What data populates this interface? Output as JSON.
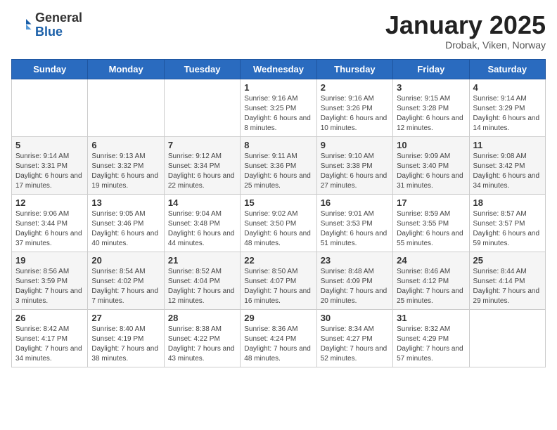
{
  "header": {
    "logo_general": "General",
    "logo_blue": "Blue",
    "month_title": "January 2025",
    "location": "Drobak, Viken, Norway"
  },
  "weekdays": [
    "Sunday",
    "Monday",
    "Tuesday",
    "Wednesday",
    "Thursday",
    "Friday",
    "Saturday"
  ],
  "weeks": [
    [
      {
        "day": "",
        "info": ""
      },
      {
        "day": "",
        "info": ""
      },
      {
        "day": "",
        "info": ""
      },
      {
        "day": "1",
        "info": "Sunrise: 9:16 AM\nSunset: 3:25 PM\nDaylight: 6 hours and 8 minutes."
      },
      {
        "day": "2",
        "info": "Sunrise: 9:16 AM\nSunset: 3:26 PM\nDaylight: 6 hours and 10 minutes."
      },
      {
        "day": "3",
        "info": "Sunrise: 9:15 AM\nSunset: 3:28 PM\nDaylight: 6 hours and 12 minutes."
      },
      {
        "day": "4",
        "info": "Sunrise: 9:14 AM\nSunset: 3:29 PM\nDaylight: 6 hours and 14 minutes."
      }
    ],
    [
      {
        "day": "5",
        "info": "Sunrise: 9:14 AM\nSunset: 3:31 PM\nDaylight: 6 hours and 17 minutes."
      },
      {
        "day": "6",
        "info": "Sunrise: 9:13 AM\nSunset: 3:32 PM\nDaylight: 6 hours and 19 minutes."
      },
      {
        "day": "7",
        "info": "Sunrise: 9:12 AM\nSunset: 3:34 PM\nDaylight: 6 hours and 22 minutes."
      },
      {
        "day": "8",
        "info": "Sunrise: 9:11 AM\nSunset: 3:36 PM\nDaylight: 6 hours and 25 minutes."
      },
      {
        "day": "9",
        "info": "Sunrise: 9:10 AM\nSunset: 3:38 PM\nDaylight: 6 hours and 27 minutes."
      },
      {
        "day": "10",
        "info": "Sunrise: 9:09 AM\nSunset: 3:40 PM\nDaylight: 6 hours and 31 minutes."
      },
      {
        "day": "11",
        "info": "Sunrise: 9:08 AM\nSunset: 3:42 PM\nDaylight: 6 hours and 34 minutes."
      }
    ],
    [
      {
        "day": "12",
        "info": "Sunrise: 9:06 AM\nSunset: 3:44 PM\nDaylight: 6 hours and 37 minutes."
      },
      {
        "day": "13",
        "info": "Sunrise: 9:05 AM\nSunset: 3:46 PM\nDaylight: 6 hours and 40 minutes."
      },
      {
        "day": "14",
        "info": "Sunrise: 9:04 AM\nSunset: 3:48 PM\nDaylight: 6 hours and 44 minutes."
      },
      {
        "day": "15",
        "info": "Sunrise: 9:02 AM\nSunset: 3:50 PM\nDaylight: 6 hours and 48 minutes."
      },
      {
        "day": "16",
        "info": "Sunrise: 9:01 AM\nSunset: 3:53 PM\nDaylight: 6 hours and 51 minutes."
      },
      {
        "day": "17",
        "info": "Sunrise: 8:59 AM\nSunset: 3:55 PM\nDaylight: 6 hours and 55 minutes."
      },
      {
        "day": "18",
        "info": "Sunrise: 8:57 AM\nSunset: 3:57 PM\nDaylight: 6 hours and 59 minutes."
      }
    ],
    [
      {
        "day": "19",
        "info": "Sunrise: 8:56 AM\nSunset: 3:59 PM\nDaylight: 7 hours and 3 minutes."
      },
      {
        "day": "20",
        "info": "Sunrise: 8:54 AM\nSunset: 4:02 PM\nDaylight: 7 hours and 7 minutes."
      },
      {
        "day": "21",
        "info": "Sunrise: 8:52 AM\nSunset: 4:04 PM\nDaylight: 7 hours and 12 minutes."
      },
      {
        "day": "22",
        "info": "Sunrise: 8:50 AM\nSunset: 4:07 PM\nDaylight: 7 hours and 16 minutes."
      },
      {
        "day": "23",
        "info": "Sunrise: 8:48 AM\nSunset: 4:09 PM\nDaylight: 7 hours and 20 minutes."
      },
      {
        "day": "24",
        "info": "Sunrise: 8:46 AM\nSunset: 4:12 PM\nDaylight: 7 hours and 25 minutes."
      },
      {
        "day": "25",
        "info": "Sunrise: 8:44 AM\nSunset: 4:14 PM\nDaylight: 7 hours and 29 minutes."
      }
    ],
    [
      {
        "day": "26",
        "info": "Sunrise: 8:42 AM\nSunset: 4:17 PM\nDaylight: 7 hours and 34 minutes."
      },
      {
        "day": "27",
        "info": "Sunrise: 8:40 AM\nSunset: 4:19 PM\nDaylight: 7 hours and 38 minutes."
      },
      {
        "day": "28",
        "info": "Sunrise: 8:38 AM\nSunset: 4:22 PM\nDaylight: 7 hours and 43 minutes."
      },
      {
        "day": "29",
        "info": "Sunrise: 8:36 AM\nSunset: 4:24 PM\nDaylight: 7 hours and 48 minutes."
      },
      {
        "day": "30",
        "info": "Sunrise: 8:34 AM\nSunset: 4:27 PM\nDaylight: 7 hours and 52 minutes."
      },
      {
        "day": "31",
        "info": "Sunrise: 8:32 AM\nSunset: 4:29 PM\nDaylight: 7 hours and 57 minutes."
      },
      {
        "day": "",
        "info": ""
      }
    ]
  ]
}
